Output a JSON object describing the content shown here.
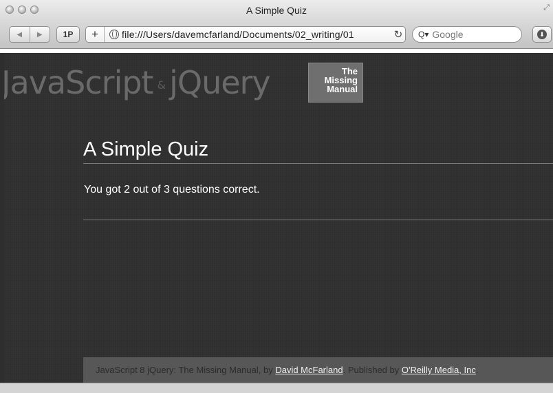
{
  "window": {
    "title": "A Simple Quiz"
  },
  "toolbar": {
    "back_icon": "◀",
    "forward_icon": "▶",
    "reader_label": "1P",
    "add_label": "+",
    "url": "file:///Users/davemcfarland/Documents/02_writing/01",
    "reload_icon": "↻",
    "search_placeholder": "Google",
    "search_icon": "Q▾"
  },
  "header": {
    "logo_part1": "JavaScript",
    "logo_amp": "&",
    "logo_part2": "jQuery",
    "badge_line1": "The",
    "badge_line2": "Missing",
    "badge_line3": "Manual"
  },
  "main": {
    "title": "A Simple Quiz",
    "result_text": "You got 2 out of 3 questions correct."
  },
  "footer": {
    "prefix": "JavaScript 8 jQuery: The Missing Manual, by ",
    "author_link": "David McFarland",
    "middle": ". Published by ",
    "publisher_link": "O'Reilly Media, Inc",
    "suffix": "."
  },
  "colors": {
    "page_background": "#2f2f2f",
    "footer_background": "#575757",
    "text_white": "#ffffff"
  }
}
